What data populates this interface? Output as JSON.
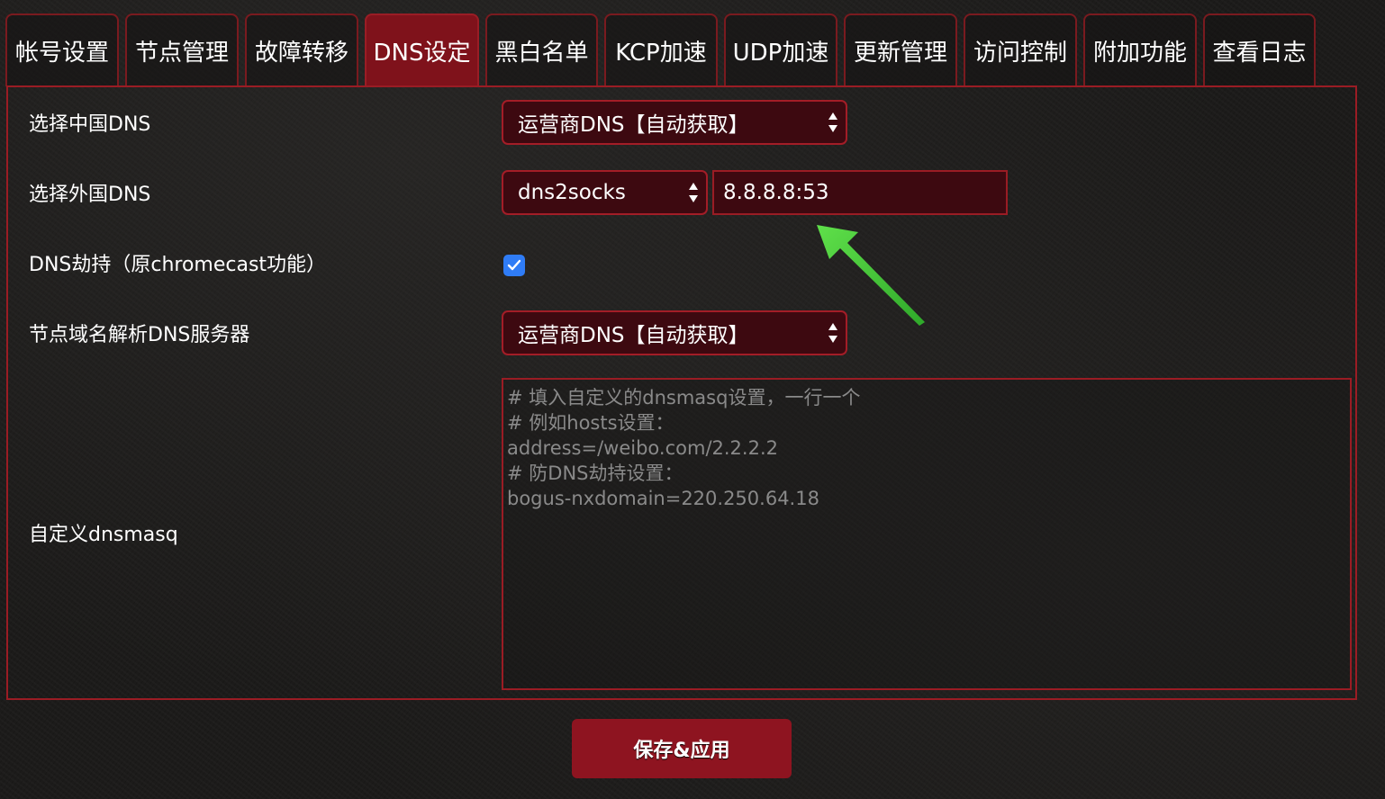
{
  "tabs": [
    {
      "label": "帐号设置"
    },
    {
      "label": "节点管理"
    },
    {
      "label": "故障转移"
    },
    {
      "label": "DNS设定",
      "active": true
    },
    {
      "label": "黑白名单"
    },
    {
      "label": "KCP加速"
    },
    {
      "label": "UDP加速"
    },
    {
      "label": "更新管理"
    },
    {
      "label": "访问控制"
    },
    {
      "label": "附加功能"
    },
    {
      "label": "查看日志"
    }
  ],
  "form": {
    "china_dns": {
      "label": "选择中国DNS",
      "value": "运营商DNS【自动获取】"
    },
    "foreign_dns": {
      "label": "选择外国DNS",
      "mode": "dns2socks",
      "server": "8.8.8.8:53"
    },
    "dns_hijack": {
      "label": "DNS劫持（原chromecast功能）",
      "checked": true
    },
    "node_dns": {
      "label": "节点域名解析DNS服务器",
      "value": "运营商DNS【自动获取】"
    },
    "custom_dnsmasq": {
      "label": "自定义dnsmasq",
      "placeholder_lines": [
        "# 填入自定义的dnsmasq设置，一行一个",
        "# 例如hosts设置：",
        "address=/weibo.com/2.2.2.2",
        "# 防DNS劫持设置：",
        "bogus-nxdomain=220.250.64.18"
      ]
    }
  },
  "save_button": {
    "label": "保存&应用"
  },
  "colors": {
    "accent": "#8e1420",
    "border": "#9a1c24",
    "field_bg": "#3d0910",
    "checkbox": "#2f7cf6",
    "annotation_arrow": "#4cd137"
  },
  "icons": {
    "select_arrows": "updown-arrows-icon",
    "checkbox": "checkmark-icon",
    "annotation": "green-arrow-icon"
  }
}
